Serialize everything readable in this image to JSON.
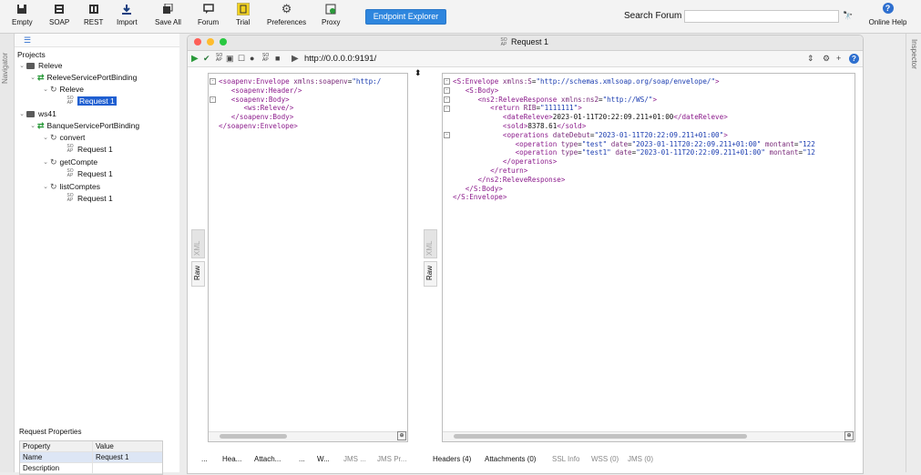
{
  "toolbar": {
    "empty": "Empty",
    "soap": "SOAP",
    "rest": "REST",
    "import": "Import",
    "save_all": "Save All",
    "forum": "Forum",
    "trial": "Trial",
    "preferences": "Preferences",
    "proxy": "Proxy",
    "endpoint_explorer": "Endpoint Explorer",
    "search_label": "Search Forum",
    "search_value": "",
    "online_help": "Online Help"
  },
  "navigator": {
    "strip_label": "Navigator",
    "projects": "Projects",
    "tree": {
      "releve": "Releve",
      "releve_binding": "ReleveServicePortBinding",
      "releve_op": "Releve",
      "releve_req": "Request 1",
      "ws41": "ws41",
      "banque_binding": "BanqueServicePortBinding",
      "op_convert": "convert",
      "convert_req": "Request 1",
      "op_getcompte": "getCompte",
      "getcompte_req": "Request 1",
      "op_listcomptes": "listComptes",
      "listcomptes_req": "Request 1",
      "soap_badge": "SO\nAP"
    }
  },
  "properties": {
    "title": "Request Properties",
    "col_property": "Property",
    "col_value": "Value",
    "rows": [
      {
        "name": "Name",
        "value": "Request 1"
      },
      {
        "name": "Description",
        "value": ""
      }
    ]
  },
  "request_window": {
    "title": "Request 1",
    "url": "http://0.0.0.0:9191/",
    "request_lines": [
      "<soapenv:Envelope xmlns:soapenv=\"http:/",
      "   <soapenv:Header/>",
      "   <soapenv:Body>",
      "      <ws:Releve/>",
      "   </soapenv:Body>",
      "</soapenv:Envelope>"
    ],
    "response_lines": [
      "<S:Envelope xmlns:S=\"http://schemas.xmlsoap.org/soap/envelope/\">",
      "   <S:Body>",
      "      <ns2:ReleveResponse xmlns:ns2=\"http://WS/\">",
      "         <return RIB=\"1111111\">",
      "            <dateReleve>2023-01-11T20:22:09.211+01:00</dateReleve>",
      "            <sold>8378.61</sold>",
      "            <operations dateDebut=\"2023-01-11T20:22:09.211+01:00\">",
      "               <operation type=\"test\" date=\"2023-01-11T20:22:09.211+01:00\" montant=\"122",
      "               <operation type=\"test1\" date=\"2023-01-11T20:22:09.211+01:00\" montant=\"12",
      "            </operations>",
      "         </return>",
      "      </ns2:ReleveResponse>",
      "   </S:Body>",
      "</S:Envelope>"
    ],
    "raw_tab": "Raw",
    "xml_tab": "XML",
    "request_tabs": [
      "...",
      "Hea...",
      "Attach...",
      "...",
      "W...",
      "JMS ...",
      "JMS Pr..."
    ],
    "response_tabs": [
      "Headers (4)",
      "Attachments (0)",
      "SSL Info",
      "WSS (0)",
      "JMS (0)"
    ]
  },
  "inspector": {
    "label": "Inspector"
  },
  "colors": {
    "accent": "#2e86de",
    "selection": "#1f5fd1",
    "xml_tag": "#8b1a8b",
    "xml_value": "#1a3cb0"
  }
}
